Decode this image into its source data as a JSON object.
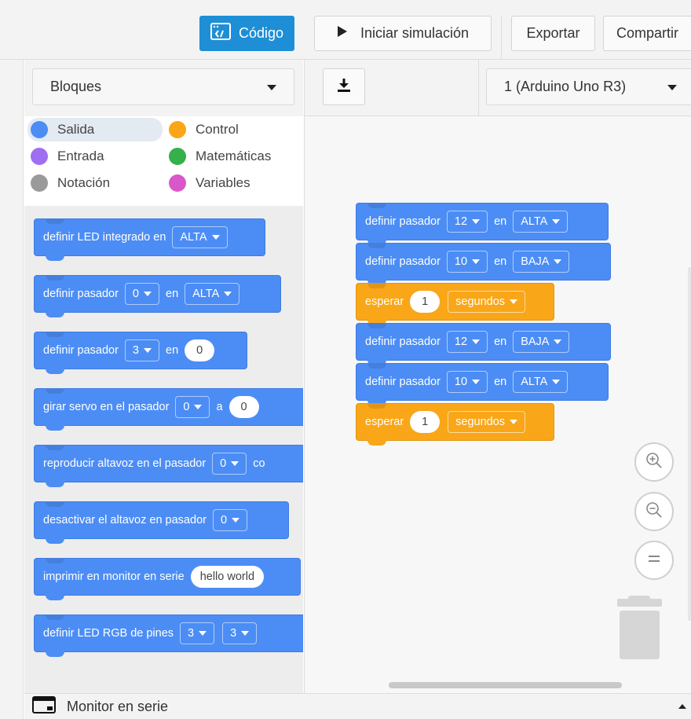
{
  "toolbar": {
    "code_label": "Código",
    "simulate_label": "Iniciar simulación",
    "export_label": "Exportar",
    "share_label": "Compartir"
  },
  "palette_header": {
    "blocks_dropdown": "Bloques",
    "board_dropdown": "1 (Arduino Uno R3)"
  },
  "categories": [
    {
      "label": "Salida",
      "color": "#4c8df5"
    },
    {
      "label": "Control",
      "color": "#f9a618"
    },
    {
      "label": "Entrada",
      "color": "#a06ef0"
    },
    {
      "label": "Matemáticas",
      "color": "#35b04a"
    },
    {
      "label": "Notación",
      "color": "#9a9a9a"
    },
    {
      "label": "Variables",
      "color": "#d958c9"
    }
  ],
  "palette_blocks": {
    "b1": {
      "text": "definir LED integrado en",
      "value": "ALTA"
    },
    "b2": {
      "text": "definir pasador",
      "pin": "0",
      "en": "en",
      "value": "ALTA"
    },
    "b3": {
      "text": "definir pasador",
      "pin": "3",
      "en": "en",
      "value": "0"
    },
    "b4": {
      "text": "girar servo en el pasador",
      "pin": "0",
      "a": "a",
      "value": "0"
    },
    "b5": {
      "text": "reproducir altavoz en el pasador",
      "pin": "0",
      "tail": "co"
    },
    "b6": {
      "text": "desactivar el altavoz en pasador",
      "pin": "0"
    },
    "b7": {
      "text": "imprimir en monitor en serie",
      "value": "hello world"
    },
    "b8": {
      "text": "definir LED RGB de pines",
      "pin1": "3",
      "pin2": "3"
    }
  },
  "workspace_blocks": {
    "w1": {
      "text": "definir pasador",
      "pin": "12",
      "en": "en",
      "value": "ALTA"
    },
    "w2": {
      "text": "definir pasador",
      "pin": "10",
      "en": "en",
      "value": "BAJA"
    },
    "w3": {
      "text": "esperar",
      "num": "1",
      "unit": "segundos"
    },
    "w4": {
      "text": "definir pasador",
      "pin": "12",
      "en": "en",
      "value": "BAJA"
    },
    "w5": {
      "text": "definir pasador",
      "pin": "10",
      "en": "en",
      "value": "ALTA"
    },
    "w6": {
      "text": "esperar",
      "num": "1",
      "unit": "segundos"
    }
  },
  "serial_monitor": {
    "label": "Monitor en serie"
  }
}
